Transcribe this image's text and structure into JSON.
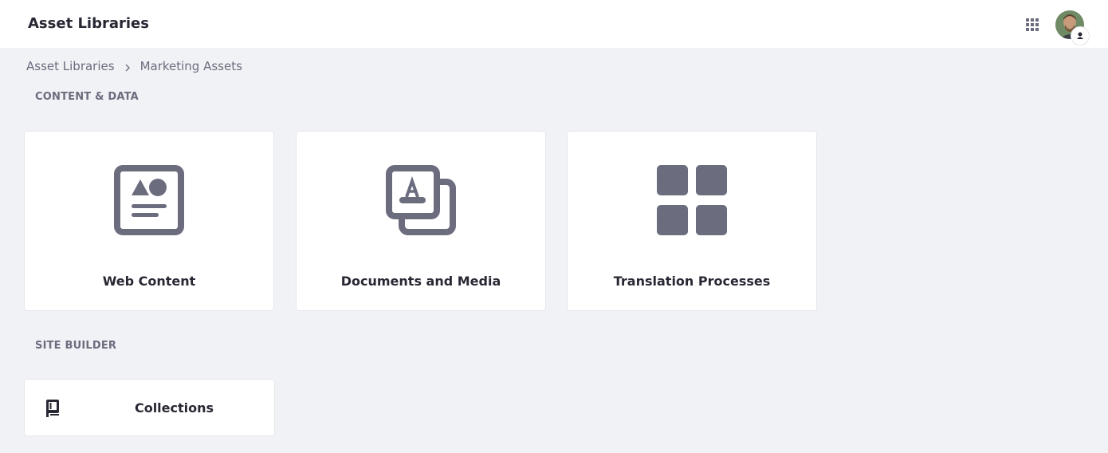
{
  "header": {
    "title": "Asset Libraries",
    "apps_icon": "apps-grid-icon",
    "avatar_icon": "user-avatar"
  },
  "breadcrumb": {
    "items": [
      "Asset Libraries",
      "Marketing Assets"
    ]
  },
  "sections": [
    {
      "label": "CONTENT & DATA",
      "cards": [
        {
          "title": "Web Content",
          "icon": "web-content-icon"
        },
        {
          "title": "Documents and Media",
          "icon": "documents-media-icon"
        },
        {
          "title": "Translation Processes",
          "icon": "translation-processes-icon"
        }
      ]
    },
    {
      "label": "SITE BUILDER",
      "cards": [
        {
          "title": "Collections",
          "icon": "collections-icon"
        }
      ]
    }
  ],
  "colors": {
    "icon": "#6b6c7e",
    "background": "#f1f2f5",
    "card": "#ffffff",
    "text": "#272833"
  }
}
